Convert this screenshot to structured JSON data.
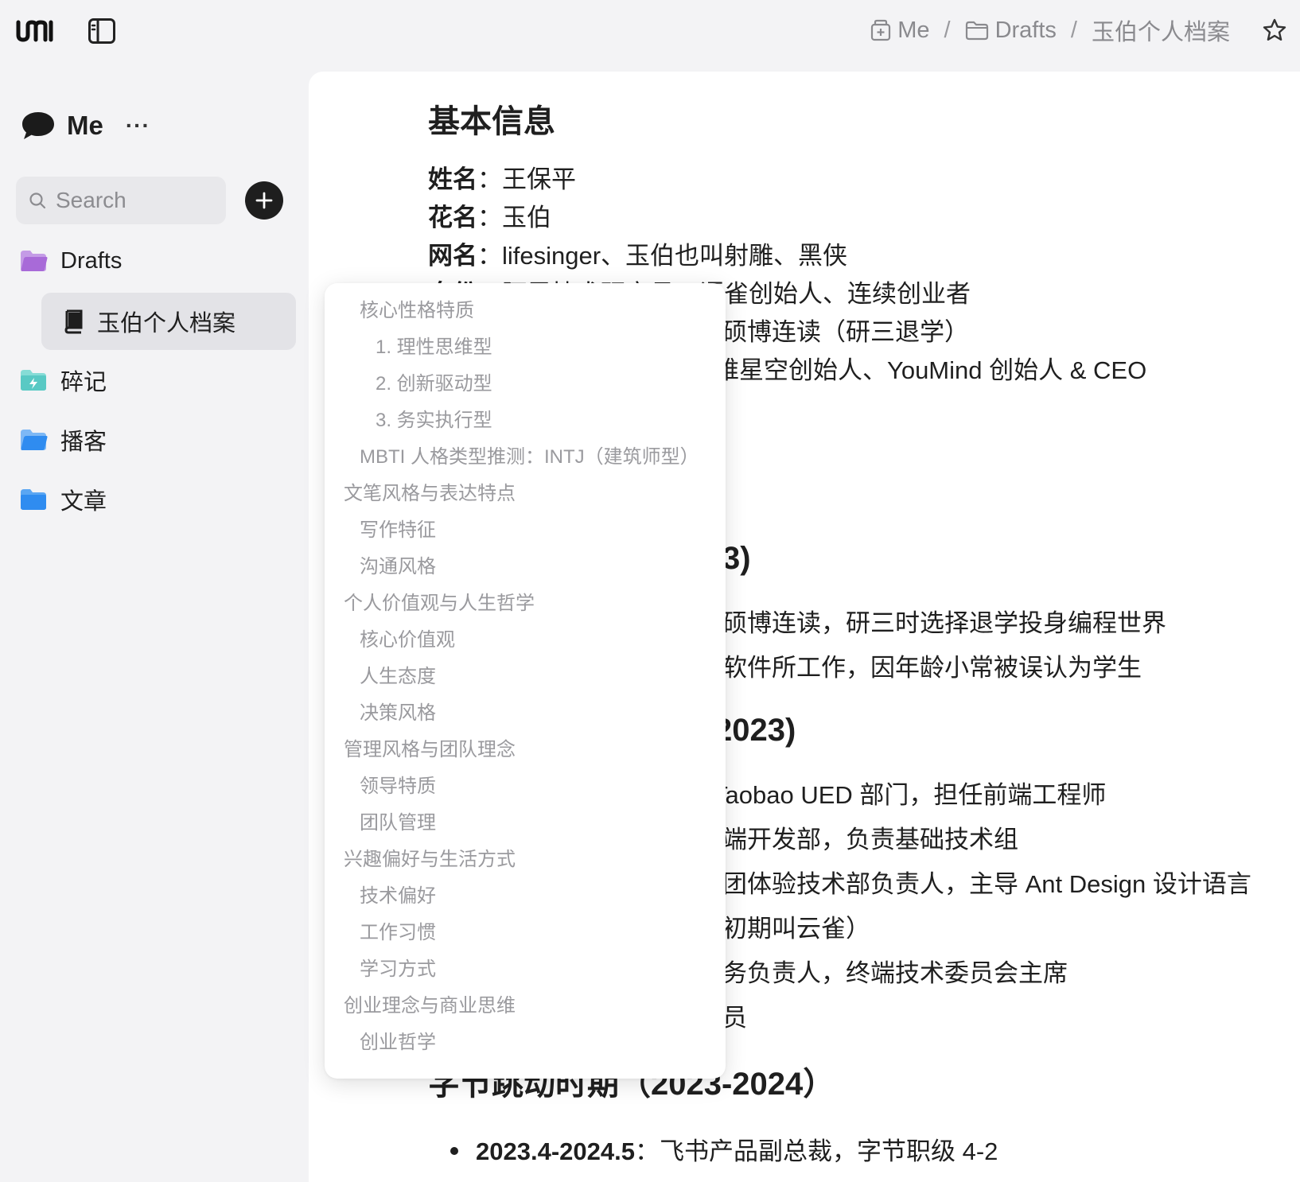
{
  "breadcrumb": {
    "space": "Me",
    "folder": "Drafts",
    "page": "玉伯个人档案",
    "separator": "/"
  },
  "sidebar": {
    "space_name": "Me",
    "more": "···",
    "search_placeholder": "Search",
    "items": [
      {
        "label": "Drafts"
      },
      {
        "label": "玉伯个人档案"
      },
      {
        "label": "碎记"
      },
      {
        "label": "播客"
      },
      {
        "label": "文章"
      }
    ]
  },
  "document": {
    "heading_basic": "基本信息",
    "fields": [
      {
        "key": "姓名",
        "sep": "：",
        "value": "王保平"
      },
      {
        "key": "花名",
        "sep": "：",
        "value": "玉伯"
      },
      {
        "key": "网名",
        "sep": "：",
        "value": "lifesinger、玉伯也叫射雕、黑侠"
      },
      {
        "key": "身份",
        "sep": "：",
        "value": "阿里技术研究员、语雀创始人、连续创业者"
      }
    ],
    "partial_lines": [
      "硕博连读（研三退学）",
      "维星空创始人、YouMind 创始人 & CEO"
    ],
    "heading_partial_1": "3)",
    "para_partial_1": [
      "硕博连读，研三时选择退学投身编程世界",
      "软件所工作，因年龄小常被误认为学生"
    ],
    "heading_partial_2": "2023)",
    "para_partial_2": [
      "Taobao UED 部门，担任前端工程师",
      "端开发部，负责基础技术组",
      "团体验技术部负责人，主导 Ant Design 设计语言",
      "初期叫云雀）",
      "务负责人，终端技术委员会主席",
      "员"
    ],
    "heading_bytedance": "字节跳动时期（2023-2024）",
    "bullet": {
      "date": "2023.4-2024.5",
      "sep": "：",
      "text": "飞书产品副总裁，字节职级 4-2"
    }
  },
  "outline": {
    "items": [
      {
        "label": "核心性格特质",
        "level": 2
      },
      {
        "label": "1. 理性思维型",
        "level": 3
      },
      {
        "label": "2. 创新驱动型",
        "level": 3
      },
      {
        "label": "3. 务实执行型",
        "level": 3
      },
      {
        "label": "MBTI 人格类型推测：INTJ（建筑师型）",
        "level": 2
      },
      {
        "label": "文笔风格与表达特点",
        "level": 1
      },
      {
        "label": "写作特征",
        "level": 2
      },
      {
        "label": "沟通风格",
        "level": 2
      },
      {
        "label": "个人价值观与人生哲学",
        "level": 1
      },
      {
        "label": "核心价值观",
        "level": 2
      },
      {
        "label": "人生态度",
        "level": 2
      },
      {
        "label": "决策风格",
        "level": 2
      },
      {
        "label": "管理风格与团队理念",
        "level": 1
      },
      {
        "label": "领导特质",
        "level": 2
      },
      {
        "label": "团队管理",
        "level": 2
      },
      {
        "label": "兴趣偏好与生活方式",
        "level": 1
      },
      {
        "label": "技术偏好",
        "level": 2
      },
      {
        "label": "工作习惯",
        "level": 2
      },
      {
        "label": "学习方式",
        "level": 2
      },
      {
        "label": "创业理念与商业思维",
        "level": 1
      },
      {
        "label": "创业哲学",
        "level": 2
      }
    ]
  },
  "colors": {
    "background": "#f3f3f5",
    "panel": "#ffffff",
    "muted_text": "#9a9a9e",
    "drafts_folder": "#a86ad8",
    "notes_folder": "#59c9c4",
    "podcast_folder": "#2f8cf0",
    "articles_folder": "#2f8cf0"
  }
}
